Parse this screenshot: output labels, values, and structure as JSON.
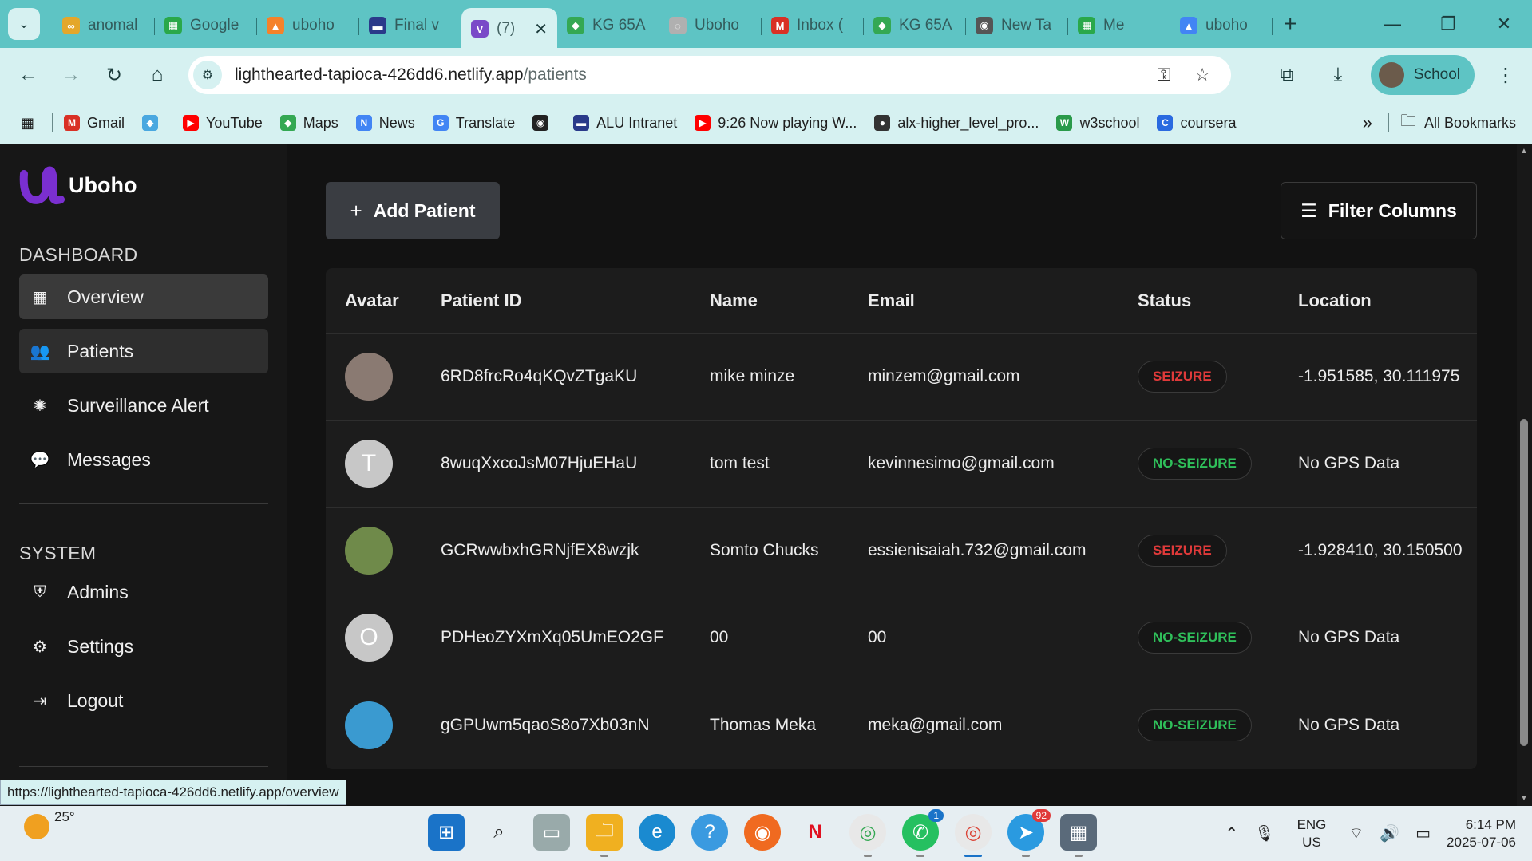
{
  "browser": {
    "tabs": [
      {
        "title": "anomal",
        "fav_color": "#e4a72a",
        "fav_glyph": "∞"
      },
      {
        "title": "Google",
        "fav_color": "#2aa84a",
        "fav_glyph": "▦"
      },
      {
        "title": "uboho",
        "fav_color": "#f5822a",
        "fav_glyph": "▲"
      },
      {
        "title": "Final v",
        "fav_color": "#2a3a8a",
        "fav_glyph": "▬"
      },
      {
        "title": "(7)",
        "fav_color": "#7a4ac8",
        "fav_glyph": "V",
        "active": true
      },
      {
        "title": "KG 65A",
        "fav_color": "#34a853",
        "fav_glyph": "◆"
      },
      {
        "title": "Uboho",
        "fav_color": "#b0b0b0",
        "fav_glyph": "◌"
      },
      {
        "title": "Inbox (",
        "fav_color": "#d93025",
        "fav_glyph": "M"
      },
      {
        "title": "KG 65A",
        "fav_color": "#34a853",
        "fav_glyph": "◆"
      },
      {
        "title": "New Ta",
        "fav_color": "#555555",
        "fav_glyph": "◉"
      },
      {
        "title": "Me",
        "fav_color": "#2aa84a",
        "fav_glyph": "▦"
      },
      {
        "title": "uboho",
        "fav_color": "#4285f4",
        "fav_glyph": "▲"
      }
    ],
    "active_tab_close": "✕",
    "url_host": "lighthearted-tapioca-426dd6.netlify.app",
    "url_path": "/patients",
    "profile_label": "School",
    "bookmarks": [
      {
        "label": "Gmail",
        "color": "#d93025",
        "glyph": "M"
      },
      {
        "label": "",
        "color": "#4aa8e0",
        "glyph": "◆"
      },
      {
        "label": "YouTube",
        "color": "#ff0000",
        "glyph": "▶"
      },
      {
        "label": "Maps",
        "color": "#34a853",
        "glyph": "◆"
      },
      {
        "label": "News",
        "color": "#4285f4",
        "glyph": "N"
      },
      {
        "label": "Translate",
        "color": "#4285f4",
        "glyph": "G"
      },
      {
        "label": "",
        "color": "#222222",
        "glyph": "◉"
      },
      {
        "label": "ALU Intranet",
        "color": "#2a3a8a",
        "glyph": "▬"
      },
      {
        "label": "9:26 Now playing W...",
        "color": "#ff0000",
        "glyph": "▶"
      },
      {
        "label": "alx-higher_level_pro...",
        "color": "#333333",
        "glyph": "●"
      },
      {
        "label": "w3school",
        "color": "#2a9a4a",
        "glyph": "W"
      },
      {
        "label": "coursera",
        "color": "#2a6ae0",
        "glyph": "C"
      }
    ],
    "all_bookmarks": "All Bookmarks",
    "status_url": "https://lighthearted-tapioca-426dd6.netlify.app/overview"
  },
  "app": {
    "brand": "Uboho",
    "dashboard_label": "DASHBOARD",
    "system_label": "SYSTEM",
    "nav": [
      {
        "label": "Overview",
        "icon": "grid-icon"
      },
      {
        "label": "Patients",
        "icon": "users-icon"
      },
      {
        "label": "Surveillance Alert",
        "icon": "aperture-icon"
      },
      {
        "label": "Messages",
        "icon": "chat-icon"
      }
    ],
    "system_nav": [
      {
        "label": "Admins",
        "icon": "shield-user-icon"
      },
      {
        "label": "Settings",
        "icon": "gear-icon"
      },
      {
        "label": "Logout",
        "icon": "logout-icon"
      }
    ],
    "add_patient": "Add Patient",
    "filter_columns": "Filter Columns",
    "columns": [
      "Avatar",
      "Patient ID",
      "Name",
      "Email",
      "Status",
      "Location"
    ],
    "rows": [
      {
        "avatar": "",
        "avatar_color": "#8a7a72",
        "id": "6RD8frcRo4qKQvZTgaKU",
        "name": "mike minze",
        "email": "minzem@gmail.com",
        "status": "SEIZURE",
        "location": "-1.951585, 30.111975"
      },
      {
        "avatar": "T",
        "avatar_color": "#c7c7c7",
        "id": "8wuqXxcoJsM07HjuEHaU",
        "name": "tom test",
        "email": "kevinnesimo@gmail.com",
        "status": "NO-SEIZURE",
        "location": "No GPS Data"
      },
      {
        "avatar": "",
        "avatar_color": "#6f8a4a",
        "id": "GCRwwbxhGRNjfEX8wzjk",
        "name": "Somto Chucks",
        "email": "essienisaiah.732@gmail.com",
        "status": "SEIZURE",
        "location": "-1.928410, 30.150500"
      },
      {
        "avatar": "O",
        "avatar_color": "#c7c7c7",
        "id": "PDHeoZYXmXq05UmEO2GF",
        "name": "00",
        "email": "00",
        "status": "NO-SEIZURE",
        "location": "No GPS Data"
      },
      {
        "avatar": "",
        "avatar_color": "#3a9ad0",
        "id": "gGPUwm5qaoS8o7Xb03nN",
        "name": "Thomas Meka",
        "email": "meka@gmail.com",
        "status": "NO-SEIZURE",
        "location": "No GPS Data"
      }
    ]
  },
  "taskbar": {
    "temperature": "25°",
    "lang_top": "ENG",
    "lang_bottom": "US",
    "time": "6:14 PM",
    "date": "2025-07-06",
    "whatsapp_badge": "1",
    "telegram_badge": "92"
  }
}
